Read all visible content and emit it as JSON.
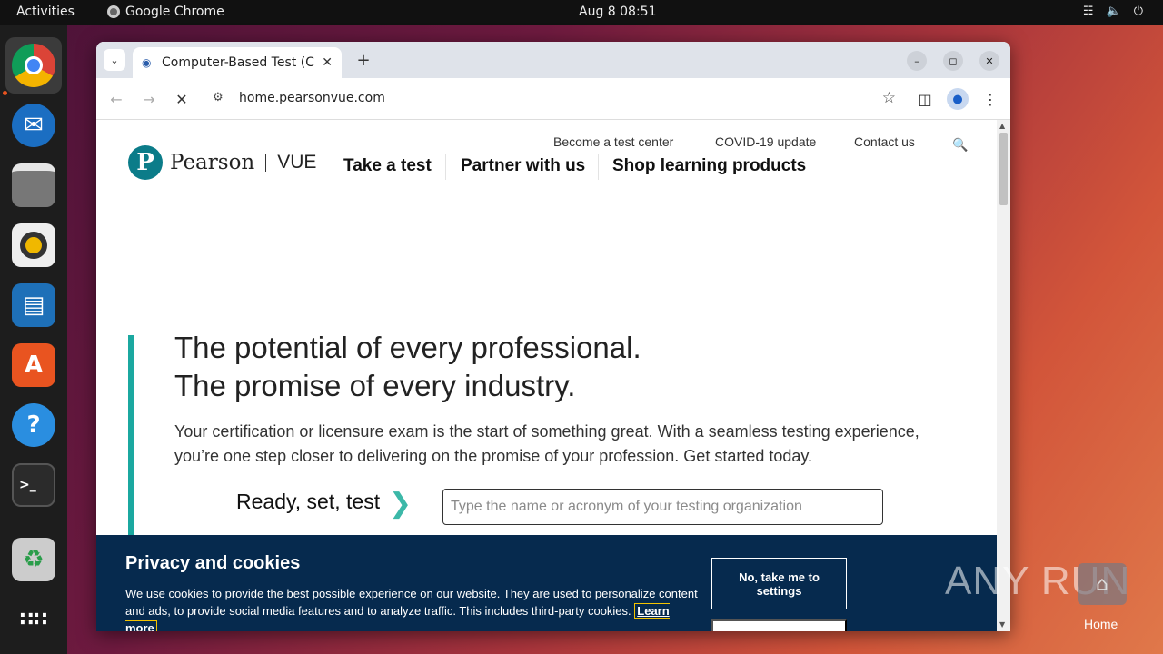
{
  "topbar": {
    "activities": "Activities",
    "app_name": "Google Chrome",
    "clock": "Aug 8  08:51"
  },
  "browser": {
    "tab_title": "Computer-Based Test (C",
    "url": "home.pearsonvue.com"
  },
  "site": {
    "logo_initial": "P",
    "logo_brand": "Pearson",
    "logo_product": "VUE",
    "util_nav": [
      "Become a test center",
      "COVID-19 update",
      "Contact us"
    ],
    "main_nav": [
      "Take a test",
      "Partner with us",
      "Shop learning products"
    ]
  },
  "hero": {
    "line1": "The potential of every professional.",
    "line2": "The promise of every industry.",
    "body": "Your certification or licensure exam is the start of something great. With a seamless testing experience, you’re one step closer to delivering on the promise of your profession. Get started today.",
    "ready_label": "Ready, set, test",
    "search_placeholder": "Type the name or acronym of your testing organization"
  },
  "cookie": {
    "title": "Privacy and cookies",
    "text": "We use cookies to provide the best possible experience on our website. They are used to personalize content and ads, to provide social media features and to analyze traffic. This includes third-party cookies.",
    "learn_more": "Learn more",
    "settings_button": "No, take me to settings"
  },
  "desktop": {
    "watermark": "ANY RUN",
    "home_label": "Home"
  },
  "colors": {
    "teal_accent": "#1ba8a0",
    "cookie_bg": "#062a4e",
    "ubuntu_orange": "#e95420"
  }
}
